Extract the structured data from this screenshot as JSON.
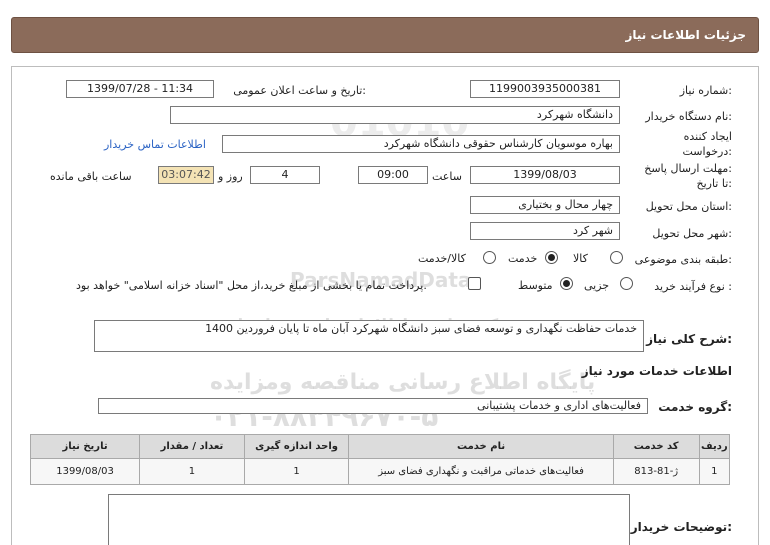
{
  "header": {
    "title": "جزئیات اطلاعات نیاز"
  },
  "form": {
    "need_number_label": "شماره نیاز:",
    "need_number": "1199003935000381",
    "announce_label": "تاریخ و ساعت اعلان عمومی:",
    "announce_value": "1399/07/28 - 11:34",
    "buyer_org_label": "نام دستگاه خریدار:",
    "buyer_org": "دانشگاه شهرکرد",
    "creator_label_1": "ایجاد کننده",
    "creator_label_2": "درخواست:",
    "creator": "بهاره موسویان کارشناس حقوقی دانشگاه شهرکرد",
    "contact_link": "اطلاعات تماس خریدار",
    "deadline_label_1": "مهلت ارسال پاسخ:",
    "deadline_label_2": "تا تاریخ:",
    "deadline_date": "1399/08/03",
    "time_label": "ساعت",
    "deadline_time": "09:00",
    "days_value": "4",
    "days_label": "روز و",
    "remaining_timer": "03:07:42",
    "remaining_label": "ساعت باقی مانده",
    "province_label": "استان محل تحویل:",
    "province": "چهار محال و بختیاری",
    "city_label": "شهر محل تحویل:",
    "city": "شهر کرد",
    "category_label": "طبقه بندی موضوعی:",
    "category_options": [
      "کالا",
      "خدمت",
      "کالا/خدمت"
    ],
    "category_selected": "خدمت",
    "process_label": "نوع فرآیند خرید :",
    "process_options": [
      "جزیی",
      "متوسط"
    ],
    "process_selected": "متوسط",
    "payment_note": "پرداخت تمام یا بخشی از مبلغ خرید،از محل \"اسناد خزانه اسلامی\" خواهد بود."
  },
  "summary": {
    "label": "شرح کلی نیاز:",
    "text": "خدمات حفاظت نگهداری و توسعه فضای سبز دانشگاه شهرکرد آبان ماه تا پایان فروردین 1400"
  },
  "services": {
    "section_title": "اطلاعات خدمات مورد نیاز",
    "group_label": "گروه خدمت:",
    "group_value": "فعالیت‌های اداری و خدمات پشتیبانی",
    "columns": [
      "ردیف",
      "کد خدمت",
      "نام خدمت",
      "واحد اندازه گیری",
      "تعداد / مقدار",
      "تاریخ نیاز"
    ],
    "rows": [
      [
        "1",
        "ژ-81-813",
        "فعالیت‌های خدماتی مراقبت و نگهداری فضای سبز",
        "1",
        "1",
        "1399/08/03"
      ]
    ]
  },
  "buyer_notes": {
    "label": "توضیحات خریدار:",
    "text": ""
  },
  "watermark": {
    "line1": "ParsNamadData",
    "line2": "مرکز فراوری اطلاعات پارس نماد داده",
    "line3": "پایگاه اطلاع رسانی مناقصه ومزایده",
    "line4": "۰۲۱-۸۸۳۴۹۶۷۰-۵"
  }
}
